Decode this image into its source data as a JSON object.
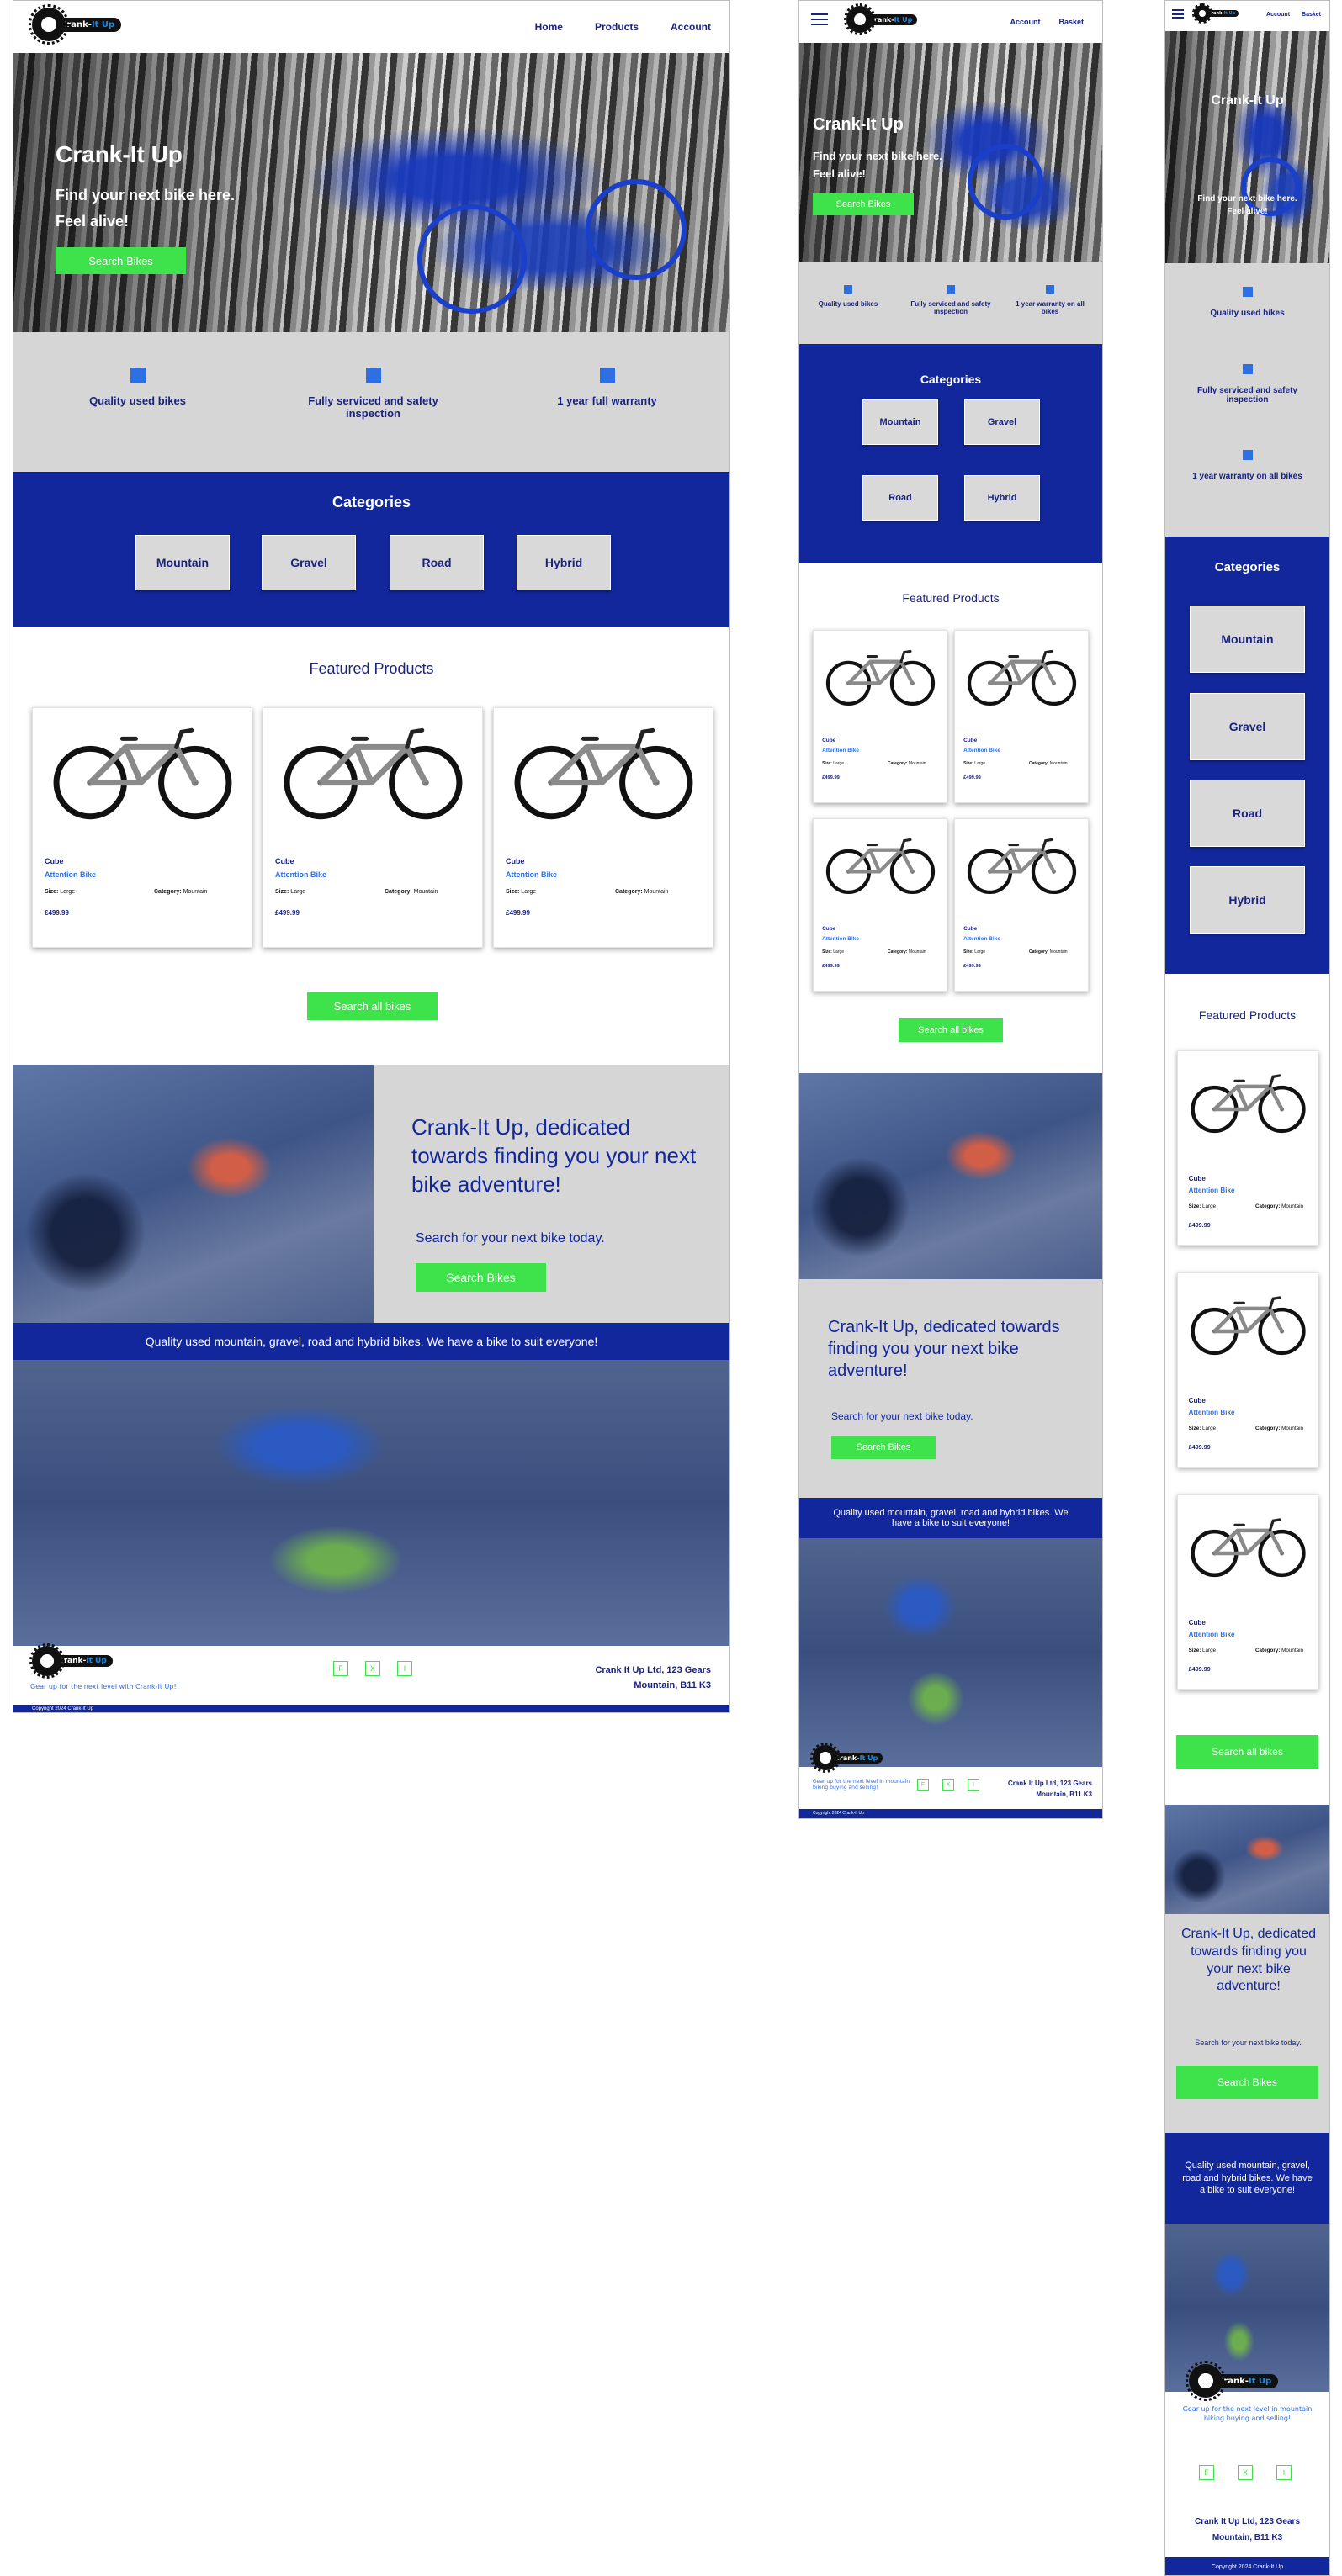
{
  "brand": {
    "pill_main": "Crank-",
    "pill_up": "It Up"
  },
  "nav": {
    "home": "Home",
    "products": "Products",
    "account": "Account",
    "basket": "Basket"
  },
  "hero": {
    "title": "Crank-It Up",
    "line1": "Find your next bike here.",
    "line2": "Feel alive!",
    "button": "Search Bikes"
  },
  "features": {
    "quality": "Quality used bikes",
    "serviced": "Fully serviced and safety inspection",
    "warranty_full": "1 year full warranty",
    "warranty_on": "1 year warranty on all bikes"
  },
  "categories": {
    "title": "Categories",
    "items": [
      "Mountain",
      "Gravel",
      "Road",
      "Hybrid"
    ]
  },
  "featured": {
    "title": "Featured Products",
    "product": {
      "brand": "Cube",
      "model": "Attention Bike",
      "size_label": "Size:",
      "size": "Large",
      "category_label": "Category:",
      "category": "Mountain",
      "price": "£499.99"
    },
    "button": "Search all bikes"
  },
  "promo": {
    "heading": "Crank-It Up, dedicated towards finding you your next bike adventure!",
    "sub": "Search for your next bike today.",
    "button": "Search Bikes"
  },
  "strip": {
    "text": "Quality used mountain, gravel, road and hybrid bikes. We have a bike to suit everyone!"
  },
  "footer": {
    "tagline": "Gear up for the next level with Crank-It Up!",
    "tagline_long": "Gear up for the next level in mountain biking buying and selling!",
    "social": [
      "F",
      "X",
      "I"
    ],
    "address1": "Crank It Up Ltd, 123 Gears",
    "address2": "Mountain, B11 K3",
    "copyright": "Copyright 2024 Crank-It Up"
  },
  "colors": {
    "navy": "#12279c",
    "green": "#3ee24a",
    "accent_blue": "#2f6fe4",
    "grey": "#d6d6d6"
  }
}
